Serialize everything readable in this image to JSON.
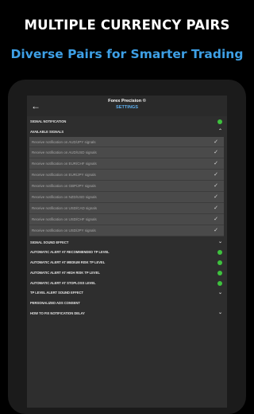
{
  "promo": {
    "title": "MULTIPLE CURRENCY PAIRS",
    "subtitle": "Diverse Pairs for Smarter Trading"
  },
  "appbar": {
    "app_name": "Forex Precision ©",
    "page_title": "SETTINGS"
  },
  "settings": {
    "signal_notification": "SIGNAL NOTIFICATION",
    "available_signals": "AVAILABLE SIGNALS",
    "signal_sound_effect": "SIGNAL SOUND EFFECT",
    "alert_recommended": "AUTOMATIC ALERT AT RECOMMENDED TP LEVEL",
    "alert_medium": "AUTOMATIC ALERT AT MEDIUM RISK TP LEVEL",
    "alert_high": "AUTOMATIC ALERT AT HIGH RISK TP LEVEL",
    "alert_stoploss": "AUTOMATIC ALERT AT STOPLOSS LEVEL",
    "tp_sound_effect": "TP LEVEL ALERT SOUND EFFECT",
    "ads_consent": "PERSONALIZED ADS CONSENT",
    "fix_delay": "HOW TO FIX NOTIFICATION DELAY"
  },
  "signals": [
    "Receive notification on AUD/JPY signals",
    "Receive notification on AUD/USD signals",
    "Receive notification on EUR/CHF signals",
    "Receive notification on EUR/JPY signals",
    "Receive notification on GBP/JPY signals",
    "Receive notification on NZD/USD signals",
    "Receive notification on USD/CAD signals",
    "Receive notification on USD/CHF signals",
    "Receive notification on USD/JPY signals"
  ],
  "colors": {
    "accent_blue": "#3ea0e6",
    "toggle_green": "#3ec23e"
  }
}
